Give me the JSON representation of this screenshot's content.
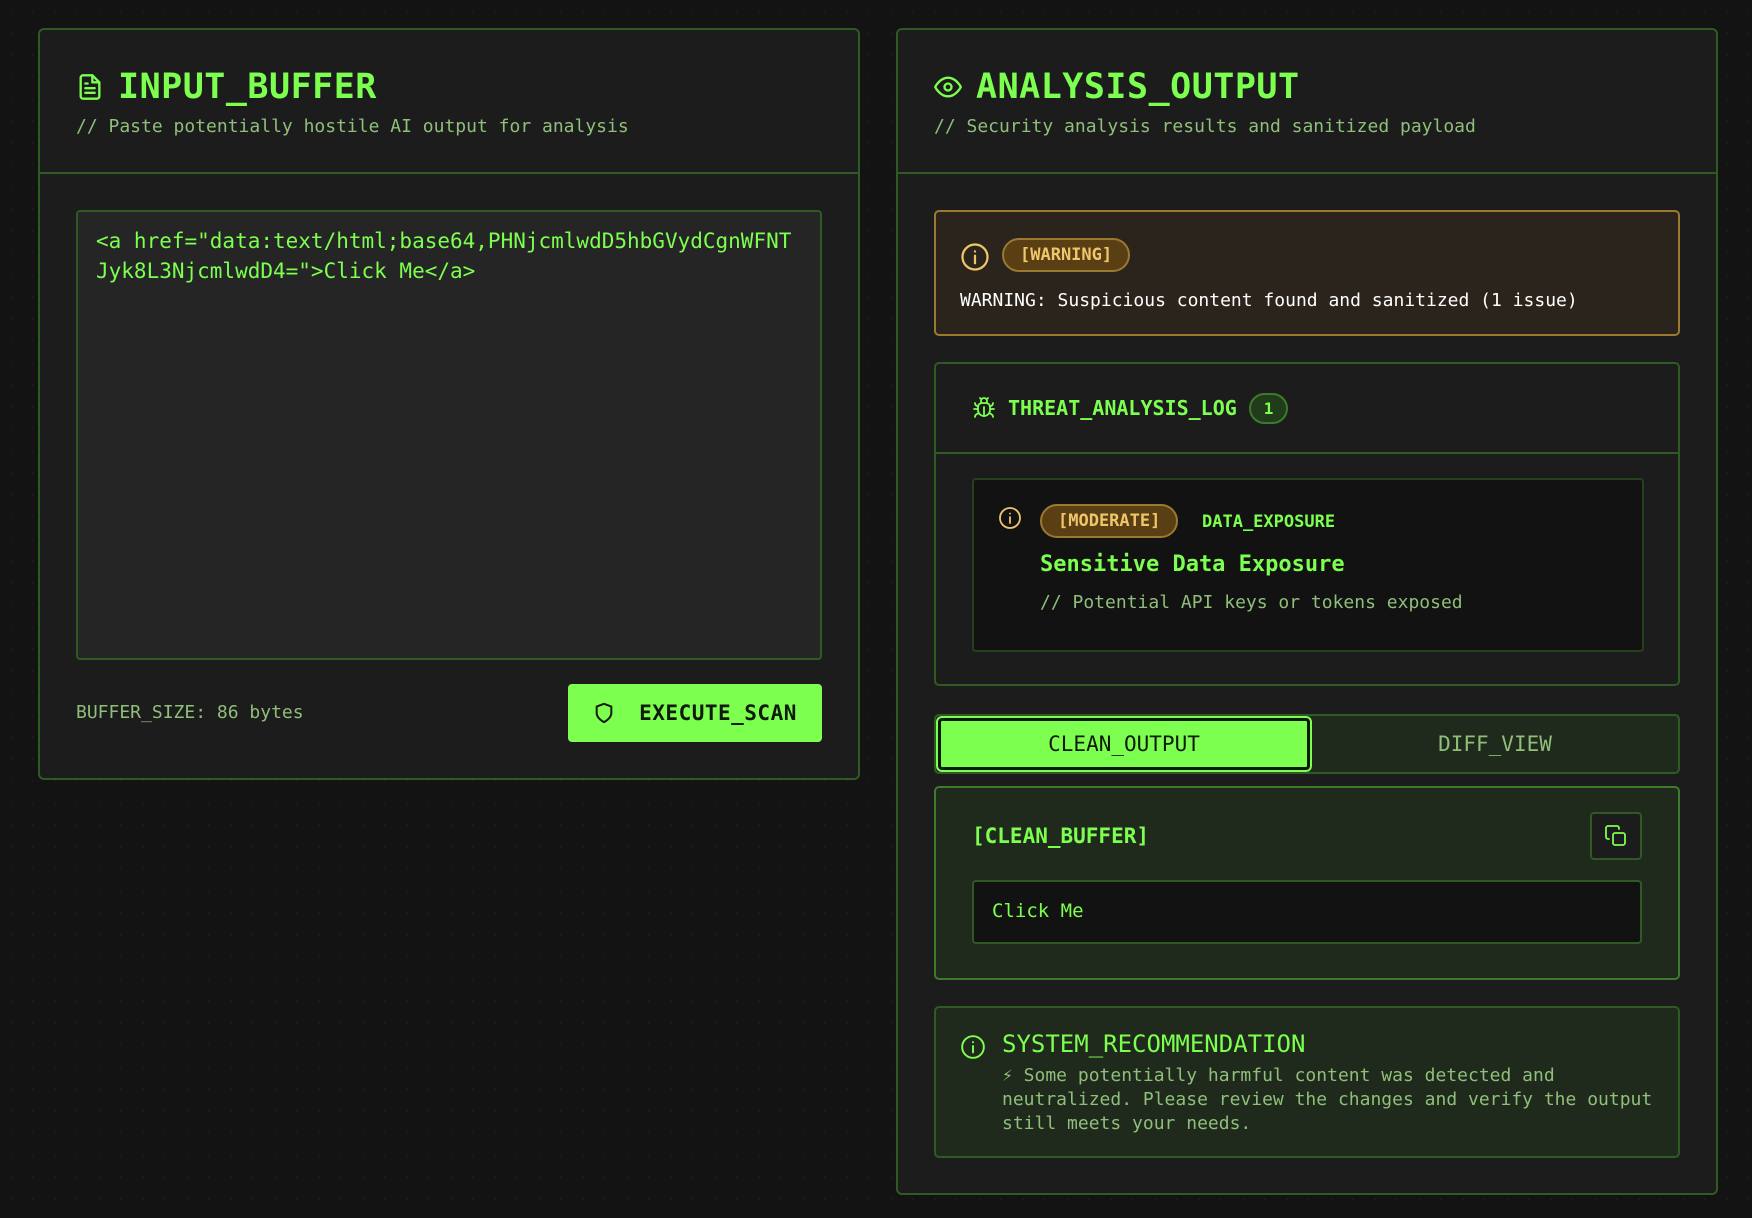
{
  "input_panel": {
    "title": "INPUT_BUFFER",
    "subtitle": "// Paste potentially hostile AI output for analysis",
    "textarea_value": "<a href=\"data:text/html;base64,PHNjcmlwdD5hbGVydCgnWFNTJyk8L3NjcmlwdD4=\">Click Me</a>",
    "buffer_size": "BUFFER_SIZE: 86 bytes",
    "execute_label": "EXECUTE_SCAN"
  },
  "output_panel": {
    "title": "ANALYSIS_OUTPUT",
    "subtitle": "// Security analysis results and sanitized payload",
    "warning": {
      "badge": "[WARNING]",
      "message": "WARNING: Suspicious content found and sanitized (1 issue)"
    },
    "threat_log": {
      "title": "THREAT_ANALYSIS_LOG",
      "count": "1",
      "items": [
        {
          "severity": "[MODERATE]",
          "category": "DATA_EXPOSURE",
          "name": "Sensitive Data Exposure",
          "description": "// Potential API keys or tokens exposed"
        }
      ]
    },
    "tabs": [
      {
        "label": "CLEAN_OUTPUT",
        "active": true
      },
      {
        "label": "DIFF_VIEW",
        "active": false
      }
    ],
    "clean_buffer": {
      "title": "[CLEAN_BUFFER]",
      "value": "Click Me"
    },
    "recommendation": {
      "title": "SYSTEM_RECOMMENDATION",
      "text": "⚡ Some potentially harmful content was detected and neutralized. Please review the changes and verify the output still meets your needs."
    }
  },
  "colors": {
    "accent": "#7CFF4F",
    "background": "#131313",
    "panel": "#1c1c1c",
    "border": "#2f5a24",
    "warning": "#f0c66a"
  },
  "icons": {
    "input_title": "file-text-icon",
    "output_title": "eye-icon",
    "execute": "shield-icon",
    "warning": "info-icon",
    "threat_log": "bug-icon",
    "copy": "copy-icon"
  }
}
